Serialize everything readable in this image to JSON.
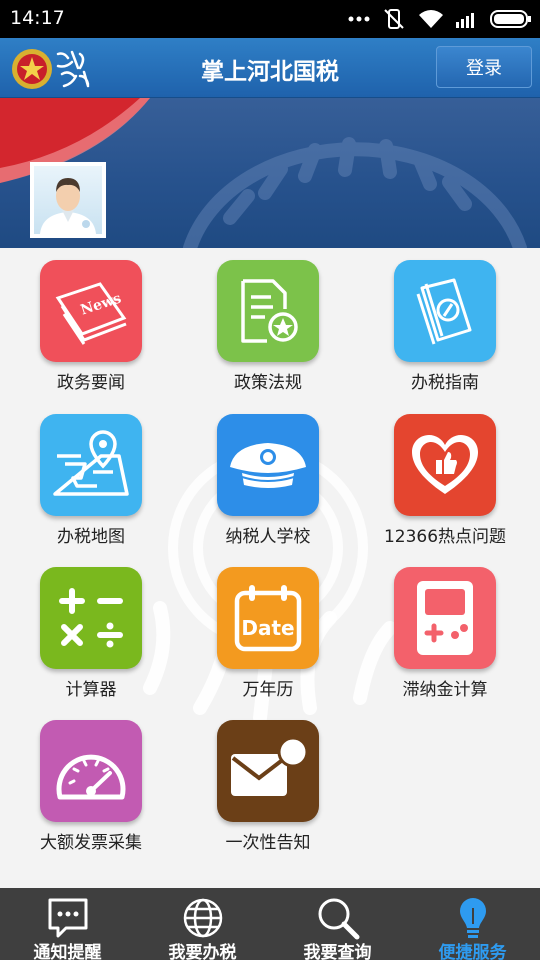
{
  "status_bar": {
    "time": "14:17"
  },
  "header": {
    "title": "掌上河北国税",
    "login_label": "登录"
  },
  "colors": {
    "header_blue": "#2f7fc6",
    "active_tab": "#2e9bf0",
    "nav_bg": "#3f3f3f"
  },
  "menu": [
    {
      "label": "政务要闻",
      "icon": "news-icon",
      "color": "#f0505a"
    },
    {
      "label": "政策法规",
      "icon": "policy-document-icon",
      "color": "#7cc24a"
    },
    {
      "label": "办税指南",
      "icon": "guide-book-icon",
      "color": "#3fb4f0"
    },
    {
      "label": "办税地图",
      "icon": "map-icon",
      "color": "#3fb4f0"
    },
    {
      "label": "纳税人学校",
      "icon": "school-cap-icon",
      "color": "#2d8ee8"
    },
    {
      "label": "12366热点问题",
      "icon": "heart-thumbs-up-icon",
      "color": "#e4452f"
    },
    {
      "label": "计算器",
      "icon": "calculator-icon",
      "color": "#7ab81e"
    },
    {
      "label": "万年历",
      "icon": "calendar-date-icon",
      "color": "#f39a1f",
      "icon_text": "Date"
    },
    {
      "label": "滞纳金计算",
      "icon": "gameboy-icon",
      "color": "#f3616b"
    },
    {
      "label": "大额发票采集",
      "icon": "gauge-icon",
      "color": "#c25bb2"
    },
    {
      "label": "一次性告知",
      "icon": "envelope-notice-icon",
      "color": "#6b3f17"
    }
  ],
  "bottom_nav": [
    {
      "label": "通知提醒",
      "icon": "message-icon"
    },
    {
      "label": "我要办税",
      "icon": "globe-icon"
    },
    {
      "label": "我要查询",
      "icon": "magnifier-icon"
    },
    {
      "label": "便捷服务",
      "icon": "lightbulb-icon",
      "active": true
    }
  ]
}
